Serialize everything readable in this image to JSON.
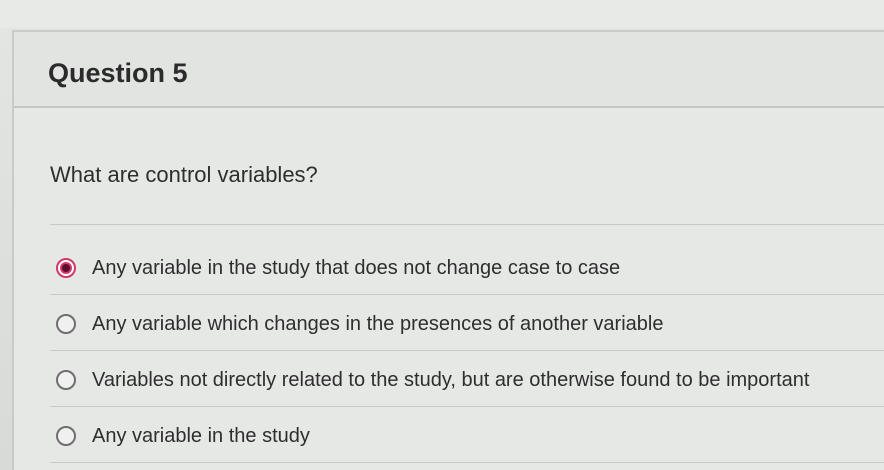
{
  "question": {
    "title": "Question 5",
    "prompt": "What are control variables?",
    "selected_index": 0,
    "options": [
      {
        "label": "Any variable in the study that does not change case to case",
        "checked": true
      },
      {
        "label": "Any variable which changes in the presences of another variable",
        "checked": false
      },
      {
        "label": "Variables not directly related to the study, but are otherwise found to be important",
        "checked": false
      },
      {
        "label": "Any variable in the study",
        "checked": false
      }
    ]
  },
  "colors": {
    "accent": "#d4386a",
    "selected_fill": "#5a0f2e",
    "background": "#e2e4e2"
  }
}
